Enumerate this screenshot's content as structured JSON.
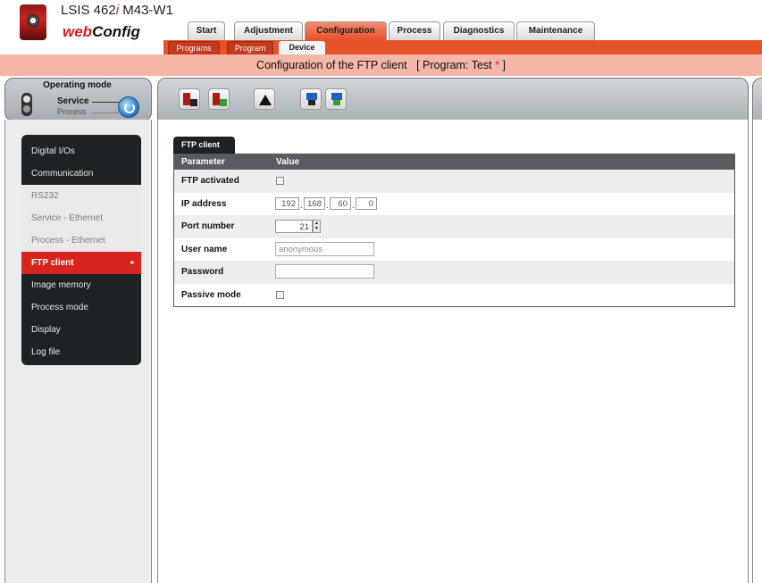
{
  "header": {
    "product_prefix": "LSIS 462",
    "product_italic": "i",
    "product_suffix": " M43-W1",
    "brand_web": "web",
    "brand_config": "Config"
  },
  "main_tabs": [
    {
      "label": "Start"
    },
    {
      "label": "Adjustment"
    },
    {
      "label": "Configuration",
      "active": true
    },
    {
      "label": "Process"
    },
    {
      "label": "Diagnostics"
    },
    {
      "label": "Maintenance"
    }
  ],
  "sub_tabs": [
    {
      "label": "Programs"
    },
    {
      "label": "Program"
    },
    {
      "label": "Device",
      "active": true
    }
  ],
  "title": {
    "text": "Configuration of the FTP client",
    "program_prefix": "[ Program: Test",
    "modified_marker": "*",
    "program_suffix": "]"
  },
  "operating_mode": {
    "heading": "Operating mode",
    "service_label": "Service",
    "process_label": "Process",
    "current": "Service"
  },
  "nav": {
    "items": [
      {
        "label": "Digital I/Os"
      },
      {
        "label": "Communication"
      },
      {
        "label": "RS232",
        "sub": true
      },
      {
        "label": "Service - Ethernet",
        "sub": true
      },
      {
        "label": "Process - Ethernet",
        "sub": true
      },
      {
        "label": "FTP client",
        "active": true,
        "arrow": "►"
      },
      {
        "label": "Image memory"
      },
      {
        "label": "Process mode"
      },
      {
        "label": "Display"
      },
      {
        "label": "Log file"
      }
    ]
  },
  "toolbar": {
    "icons": [
      "device-upload-icon",
      "device-download-icon",
      "recycle-icon",
      "pc-upload-icon",
      "pc-download-icon"
    ]
  },
  "ftp": {
    "tab_label": "FTP client",
    "col_parameter": "Parameter",
    "col_value": "Value",
    "rows": {
      "ftp_activated": {
        "label": "FTP activated",
        "checked": false
      },
      "ip_address": {
        "label": "IP address",
        "octets": [
          "192",
          "168",
          "60",
          "0"
        ]
      },
      "port_number": {
        "label": "Port number",
        "value": "21"
      },
      "user_name": {
        "label": "User name",
        "value": "anonymous"
      },
      "password": {
        "label": "Password",
        "value": ""
      },
      "passive_mode": {
        "label": "Passive mode",
        "checked": false
      }
    }
  },
  "colors": {
    "accent": "#e6532a",
    "nav_bg": "#1d2225",
    "nav_active": "#d6231d",
    "title_band": "#f5b6a8"
  }
}
